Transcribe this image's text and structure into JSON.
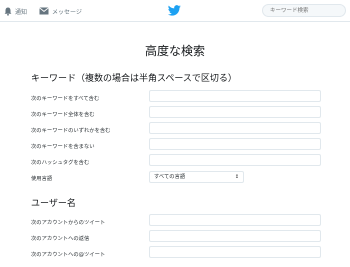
{
  "topbar": {
    "notifications_label": "通知",
    "messages_label": "メッセージ",
    "search_placeholder": "キーワード検索"
  },
  "main": {
    "page_title": "高度な検索",
    "keyword_section": {
      "title": "キーワード（複数の場合は半角スペースで区切る）",
      "rows": [
        {
          "label": "次のキーワードをすべて含む",
          "value": ""
        },
        {
          "label": "次のキーワード全体を含む",
          "value": ""
        },
        {
          "label": "次のキーワードのいずれかを含む",
          "value": ""
        },
        {
          "label": "次のキーワードを含まない",
          "value": ""
        },
        {
          "label": "次のハッシュタグを含む",
          "value": ""
        }
      ],
      "language_label": "使用言語",
      "language_value": "すべての言語"
    },
    "user_section": {
      "title": "ユーザー名",
      "rows": [
        {
          "label": "次のアカウントからのツイート",
          "value": ""
        },
        {
          "label": "次のアカウントへの返信",
          "value": ""
        },
        {
          "label": "次のアカウントへの@ツイート",
          "value": ""
        }
      ]
    }
  },
  "colors": {
    "brand": "#1da1f2",
    "nav_icon": "#66757f",
    "border": "#e1e8ed"
  },
  "icons": {
    "notifications": "bell-icon",
    "messages": "envelope-icon",
    "logo": "bird-logo-icon",
    "select": "updown-arrows-icon"
  }
}
